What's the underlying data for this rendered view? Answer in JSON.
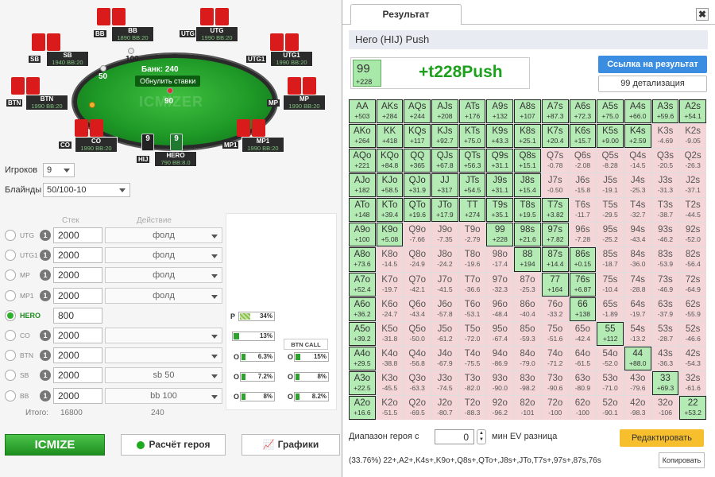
{
  "table": {
    "pot_label": "Банк: 240",
    "reset_label": "Обнулить ставки",
    "watermark": "ICMIZER",
    "hero_bet": "90",
    "bb_bet": "100",
    "sb_bet": "50"
  },
  "seats": [
    {
      "pos": "BB",
      "name": "BB",
      "stack": "1890",
      "bb": "BB:20"
    },
    {
      "pos": "UTG",
      "name": "UTG",
      "stack": "1990",
      "bb": "BB:20"
    },
    {
      "pos": "SB",
      "name": "SB",
      "stack": "1940",
      "bb": "BB:20"
    },
    {
      "pos": "UTG1",
      "name": "UTG1",
      "stack": "1990",
      "bb": "BB:20"
    },
    {
      "pos": "BTN",
      "name": "BTN",
      "stack": "1990",
      "bb": "BB:20"
    },
    {
      "pos": "MP",
      "name": "MP",
      "stack": "1990",
      "bb": "BB:20"
    },
    {
      "pos": "CO",
      "name": "CO",
      "stack": "1990",
      "bb": "BB:20"
    },
    {
      "pos": "MP1",
      "name": "MP1",
      "stack": "1990",
      "bb": "BB:20"
    },
    {
      "pos": "HIJ",
      "name": "HERO",
      "stack": "790",
      "bb": "BB:8.0"
    }
  ],
  "hero_cards": [
    "9",
    "9"
  ],
  "settings": {
    "players_label": "Игроков",
    "players_value": "9",
    "blinds_label": "Блайнды",
    "blinds_value": "50/100-10"
  },
  "columns": {
    "stack": "Стек",
    "action": "Действие"
  },
  "players": [
    {
      "name": "UTG",
      "num": "1",
      "stack": "2000",
      "action": "фолд"
    },
    {
      "name": "UTG1",
      "num": "1",
      "stack": "2000",
      "action": "фолд"
    },
    {
      "name": "MP",
      "num": "1",
      "stack": "2000",
      "action": "фолд"
    },
    {
      "name": "MP1",
      "num": "1",
      "stack": "2000",
      "action": "фолд"
    },
    {
      "name": "HERO",
      "num": "",
      "stack": "800",
      "action": ""
    },
    {
      "name": "CO",
      "num": "1",
      "stack": "2000",
      "action": ""
    },
    {
      "name": "BTN",
      "num": "1",
      "stack": "2000",
      "action": ""
    },
    {
      "name": "SB",
      "num": "1",
      "stack": "2000",
      "action": "sb 50"
    },
    {
      "name": "BB",
      "num": "1",
      "stack": "2000",
      "action": "bb 100"
    }
  ],
  "totals": {
    "label": "Итого:",
    "stack": "16800",
    "action": "240"
  },
  "bars": {
    "p_label": "P",
    "p_value": "34%",
    "co_value": "13%",
    "btn_call_label": "BTN CALL",
    "o1": "6.3%",
    "o1b": "15%",
    "o2": "7.2%",
    "o2b": "8%",
    "o3": "8%",
    "o3b": "8.2%",
    "o_label": "O"
  },
  "buttons": {
    "icmize": "ICMIZE",
    "calc": "Расчёт героя",
    "graphs": "Графики"
  },
  "result": {
    "tab": "Результат",
    "title": "Hero (HIJ) Push",
    "hand": "99",
    "hand_ev": "+228",
    "big": "+t228Push",
    "link_btn": "Ссылка на результат",
    "detail_btn": "99 детализация",
    "range_label": "Диапазон героя с",
    "range_value": "0",
    "min_label": "мин EV разница",
    "edit_btn": "Редактировать",
    "range_str": "(33.76%) 22+,A2+,K4s+,K9o+,Q8s+,QTo+,J8s+,JTo,T7s+,97s+,87s,76s",
    "copy_btn": "Копировать"
  },
  "grid": [
    [
      [
        "AA",
        "+503",
        1
      ],
      [
        "AKs",
        "+284",
        1
      ],
      [
        "AQs",
        "+244",
        1
      ],
      [
        "AJs",
        "+208",
        1
      ],
      [
        "ATs",
        "+176",
        1
      ],
      [
        "A9s",
        "+132",
        1
      ],
      [
        "A8s",
        "+107",
        1
      ],
      [
        "A7s",
        "+87.3",
        1
      ],
      [
        "A6s",
        "+72.3",
        1
      ],
      [
        "A5s",
        "+75.0",
        1
      ],
      [
        "A4s",
        "+66.0",
        1
      ],
      [
        "A3s",
        "+59.6",
        1
      ],
      [
        "A2s",
        "+54.1",
        1
      ]
    ],
    [
      [
        "AKo",
        "+264",
        1
      ],
      [
        "KK",
        "+418",
        1
      ],
      [
        "KQs",
        "+117",
        1
      ],
      [
        "KJs",
        "+92.7",
        1
      ],
      [
        "KTs",
        "+75.0",
        1
      ],
      [
        "K9s",
        "+43.3",
        1
      ],
      [
        "K8s",
        "+25.1",
        1
      ],
      [
        "K7s",
        "+20.4",
        1
      ],
      [
        "K6s",
        "+15.7",
        1
      ],
      [
        "K5s",
        "+9.00",
        1
      ],
      [
        "K4s",
        "+2.59",
        1
      ],
      [
        "K3s",
        "-4.69",
        0
      ],
      [
        "K2s",
        "-9.05",
        0
      ]
    ],
    [
      [
        "AQo",
        "+221",
        1
      ],
      [
        "KQo",
        "+84.8",
        1
      ],
      [
        "QQ",
        "+365",
        1
      ],
      [
        "QJs",
        "+67.8",
        1
      ],
      [
        "QTs",
        "+56.3",
        1
      ],
      [
        "Q9s",
        "+31.1",
        1
      ],
      [
        "Q8s",
        "+15.1",
        1
      ],
      [
        "Q7s",
        "-0.78",
        0
      ],
      [
        "Q6s",
        "-2.08",
        0
      ],
      [
        "Q5s",
        "-8.28",
        0
      ],
      [
        "Q4s",
        "-14.5",
        0
      ],
      [
        "Q3s",
        "-20.5",
        0
      ],
      [
        "Q2s",
        "-26.3",
        0
      ]
    ],
    [
      [
        "AJo",
        "+182",
        1
      ],
      [
        "KJo",
        "+58.5",
        1
      ],
      [
        "QJo",
        "+31.9",
        1
      ],
      [
        "JJ",
        "+317",
        1
      ],
      [
        "JTs",
        "+54.5",
        1
      ],
      [
        "J9s",
        "+31.1",
        1
      ],
      [
        "J8s",
        "+15.4",
        1
      ],
      [
        "J7s",
        "-0.50",
        0
      ],
      [
        "J6s",
        "-15.8",
        0
      ],
      [
        "J5s",
        "-19.1",
        0
      ],
      [
        "J4s",
        "-25.3",
        0
      ],
      [
        "J3s",
        "-31.3",
        0
      ],
      [
        "J2s",
        "-37.1",
        0
      ]
    ],
    [
      [
        "ATo",
        "+148",
        1
      ],
      [
        "KTo",
        "+39.4",
        1
      ],
      [
        "QTo",
        "+19.6",
        1
      ],
      [
        "JTo",
        "+17.9",
        1
      ],
      [
        "TT",
        "+274",
        1
      ],
      [
        "T9s",
        "+35.1",
        1
      ],
      [
        "T8s",
        "+19.5",
        1
      ],
      [
        "T7s",
        "+3.82",
        1
      ],
      [
        "T6s",
        "-11.7",
        0
      ],
      [
        "T5s",
        "-29.5",
        0
      ],
      [
        "T4s",
        "-32.7",
        0
      ],
      [
        "T3s",
        "-38.7",
        0
      ],
      [
        "T2s",
        "-44.5",
        0
      ]
    ],
    [
      [
        "A9o",
        "+100",
        1
      ],
      [
        "K9o",
        "+5.08",
        1
      ],
      [
        "Q9o",
        "-7.66",
        0
      ],
      [
        "J9o",
        "-7.35",
        0
      ],
      [
        "T9o",
        "-2.79",
        0
      ],
      [
        "99",
        "+228",
        1
      ],
      [
        "98s",
        "+21.6",
        1
      ],
      [
        "97s",
        "+7.82",
        1
      ],
      [
        "96s",
        "-7.28",
        0
      ],
      [
        "95s",
        "-25.2",
        0
      ],
      [
        "94s",
        "-43.4",
        0
      ],
      [
        "93s",
        "-46.2",
        0
      ],
      [
        "92s",
        "-52.0",
        0
      ]
    ],
    [
      [
        "A8o",
        "+73.6",
        1
      ],
      [
        "K8o",
        "-14.5",
        0
      ],
      [
        "Q8o",
        "-24.9",
        0
      ],
      [
        "J8o",
        "-24.2",
        0
      ],
      [
        "T8o",
        "-19.6",
        0
      ],
      [
        "98o",
        "-17.4",
        0
      ],
      [
        "88",
        "+194",
        1
      ],
      [
        "87s",
        "+14.4",
        1
      ],
      [
        "86s",
        "+0.15",
        1
      ],
      [
        "85s",
        "-18.7",
        0
      ],
      [
        "84s",
        "-36.0",
        0
      ],
      [
        "83s",
        "-53.9",
        0
      ],
      [
        "82s",
        "-56.4",
        0
      ]
    ],
    [
      [
        "A7o",
        "+52.4",
        1
      ],
      [
        "K7o",
        "-19.7",
        0
      ],
      [
        "Q7o",
        "-42.1",
        0
      ],
      [
        "J7o",
        "-41.5",
        0
      ],
      [
        "T7o",
        "-36.6",
        0
      ],
      [
        "97o",
        "-32.3",
        0
      ],
      [
        "87o",
        "-25.3",
        0
      ],
      [
        "77",
        "+164",
        1
      ],
      [
        "76s",
        "+6.87",
        1
      ],
      [
        "75s",
        "-10.4",
        0
      ],
      [
        "74s",
        "-28.8",
        0
      ],
      [
        "73s",
        "-46.9",
        0
      ],
      [
        "72s",
        "-64.9",
        0
      ]
    ],
    [
      [
        "A6o",
        "+36.2",
        1
      ],
      [
        "K6o",
        "-24.7",
        0
      ],
      [
        "Q6o",
        "-43.4",
        0
      ],
      [
        "J6o",
        "-57.8",
        0
      ],
      [
        "T6o",
        "-53.1",
        0
      ],
      [
        "96o",
        "-48.4",
        0
      ],
      [
        "86o",
        "-40.4",
        0
      ],
      [
        "76o",
        "-33.2",
        0
      ],
      [
        "66",
        "+138",
        1
      ],
      [
        "65s",
        "-1.89",
        0
      ],
      [
        "64s",
        "-19.7",
        0
      ],
      [
        "63s",
        "-37.9",
        0
      ],
      [
        "62s",
        "-55.9",
        0
      ]
    ],
    [
      [
        "A5o",
        "+39.2",
        1
      ],
      [
        "K5o",
        "-31.8",
        0
      ],
      [
        "Q5o",
        "-50.0",
        0
      ],
      [
        "J5o",
        "-61.2",
        0
      ],
      [
        "T5o",
        "-72.0",
        0
      ],
      [
        "95o",
        "-67.4",
        0
      ],
      [
        "85o",
        "-59.3",
        0
      ],
      [
        "75o",
        "-51.6",
        0
      ],
      [
        "65o",
        "-42.4",
        0
      ],
      [
        "55",
        "+112",
        1
      ],
      [
        "54s",
        "-13.2",
        0
      ],
      [
        "53s",
        "-28.7",
        0
      ],
      [
        "52s",
        "-46.6",
        0
      ]
    ],
    [
      [
        "A4o",
        "+29.5",
        1
      ],
      [
        "K4o",
        "-38.8",
        0
      ],
      [
        "Q4o",
        "-56.8",
        0
      ],
      [
        "J4o",
        "-67.9",
        0
      ],
      [
        "T4o",
        "-75.5",
        0
      ],
      [
        "94o",
        "-86.9",
        0
      ],
      [
        "84o",
        "-79.0",
        0
      ],
      [
        "74o",
        "-71.2",
        0
      ],
      [
        "64o",
        "-61.5",
        0
      ],
      [
        "54o",
        "-52.0",
        0
      ],
      [
        "44",
        "+88.0",
        1
      ],
      [
        "43s",
        "-36.3",
        0
      ],
      [
        "42s",
        "-54.3",
        0
      ]
    ],
    [
      [
        "A3o",
        "+22.5",
        1
      ],
      [
        "K3o",
        "-45.5",
        0
      ],
      [
        "Q3o",
        "-63.3",
        0
      ],
      [
        "J3o",
        "-74.5",
        0
      ],
      [
        "T3o",
        "-82.0",
        0
      ],
      [
        "93o",
        "-90.0",
        0
      ],
      [
        "83o",
        "-98.2",
        0
      ],
      [
        "73o",
        "-90.6",
        0
      ],
      [
        "63o",
        "-80.9",
        0
      ],
      [
        "53o",
        "-71.0",
        0
      ],
      [
        "43o",
        "-79.6",
        0
      ],
      [
        "33",
        "+69.3",
        1
      ],
      [
        "32s",
        "-61.6",
        0
      ]
    ],
    [
      [
        "A2o",
        "+16.6",
        1
      ],
      [
        "K2o",
        "-51.5",
        0
      ],
      [
        "Q2o",
        "-69.5",
        0
      ],
      [
        "J2o",
        "-80.7",
        0
      ],
      [
        "T2o",
        "-88.3",
        0
      ],
      [
        "92o",
        "-96.2",
        0
      ],
      [
        "82o",
        "-101",
        0
      ],
      [
        "72o",
        "-100",
        0
      ],
      [
        "62o",
        "-100",
        0
      ],
      [
        "52o",
        "-90.1",
        0
      ],
      [
        "42o",
        "-98.3",
        0
      ],
      [
        "32o",
        "-106",
        0
      ],
      [
        "22",
        "+53.2",
        1
      ]
    ]
  ]
}
